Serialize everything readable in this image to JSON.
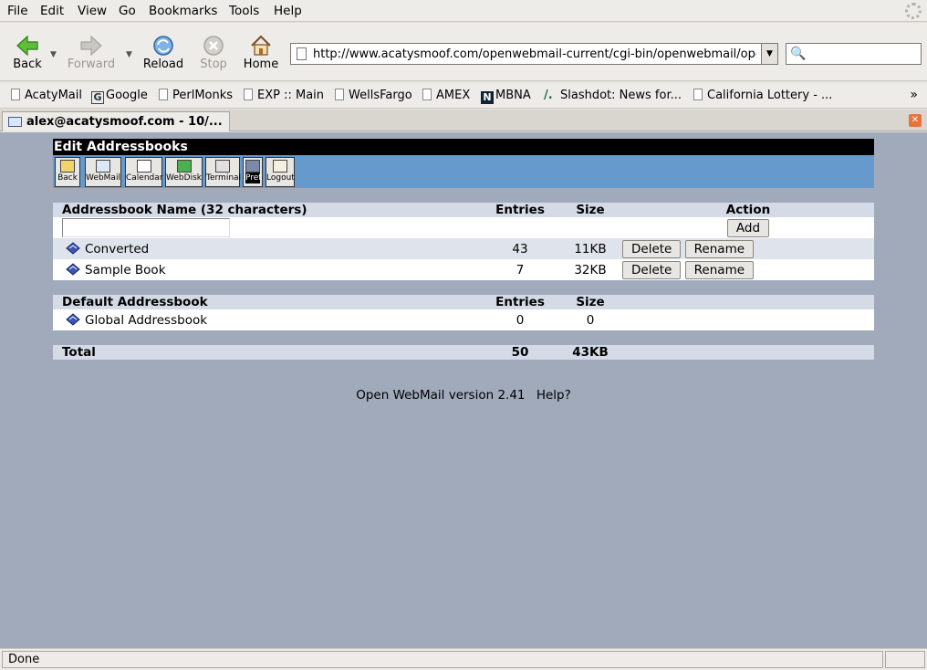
{
  "menu": {
    "items": [
      "File",
      "Edit",
      "View",
      "Go",
      "Bookmarks",
      "Tools",
      "Help"
    ]
  },
  "nav": {
    "back": "Back",
    "forward": "Forward",
    "reload": "Reload",
    "stop": "Stop",
    "home": "Home",
    "url": "http://www.acatysmoof.com/openwebmail-current/cgi-bin/openwebmail/openwebmail-abook.pl"
  },
  "bookmarks": [
    "AcatyMail",
    "Google",
    "PerlMonks",
    "EXP :: Main",
    "WellsFargo",
    "AMEX",
    "MBNA",
    "Slashdot: News for...",
    "California Lottery - ..."
  ],
  "tab": {
    "title": "alex@acatysmoof.com - 10/..."
  },
  "page": {
    "title": "Edit Addressbooks",
    "toolbar": [
      "Back",
      "WebMail",
      "Calendar",
      "WebDisk",
      "Terminal",
      "Pref",
      "Logout"
    ],
    "books_table": {
      "col_name": "Addressbook Name (32 characters)",
      "col_entries": "Entries",
      "col_size": "Size",
      "col_action": "Action",
      "add_label": "Add",
      "rows": [
        {
          "name": "Converted",
          "entries": "43",
          "size": "11KB",
          "delete": "Delete",
          "rename": "Rename"
        },
        {
          "name": "Sample Book",
          "entries": "7",
          "size": "32KB",
          "delete": "Delete",
          "rename": "Rename"
        }
      ]
    },
    "default_table": {
      "col_name": "Default Addressbook",
      "col_entries": "Entries",
      "col_size": "Size",
      "rows": [
        {
          "name": "Global Addressbook",
          "entries": "0",
          "size": "0"
        }
      ]
    },
    "total": {
      "label": "Total",
      "entries": "50",
      "size": "43KB"
    },
    "footer": {
      "version": "Open WebMail version 2.41",
      "help": "Help?"
    }
  },
  "status": {
    "text": "Done"
  }
}
